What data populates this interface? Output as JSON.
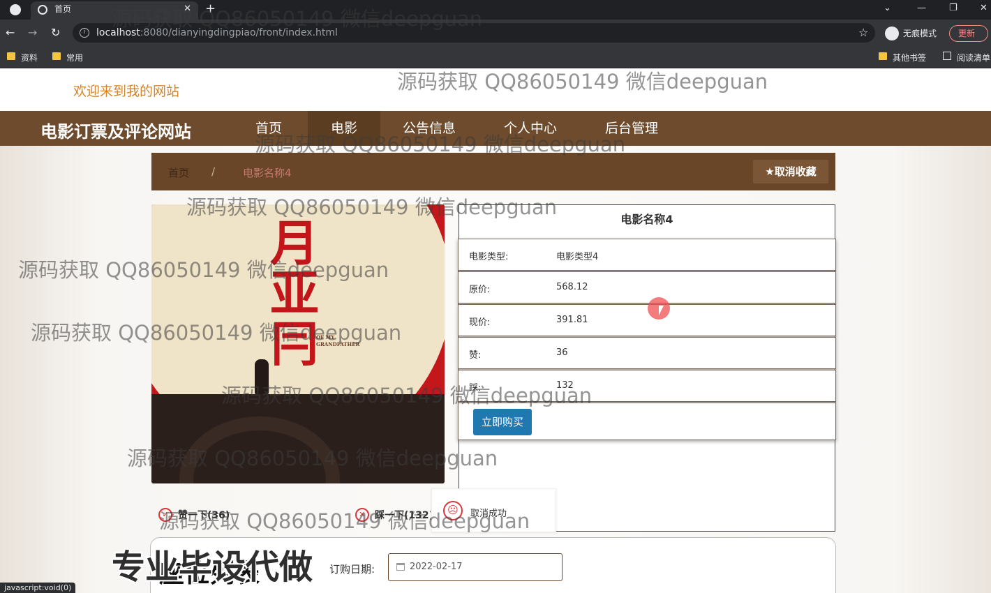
{
  "browser": {
    "tab_title": "首页",
    "url_host": "localhost",
    "url_rest": ":8080/dianyingdingpiao/front/index.html",
    "incognito_label": "无痕模式",
    "update_label": "更新",
    "bookmarks": [
      "资料",
      "常用"
    ],
    "bookmarks_right": [
      "其他书签",
      "阅读清单"
    ],
    "status_text": "javascript:void(0)"
  },
  "site": {
    "welcome": "欢迎来到我的网站",
    "title": "电影订票及评论网站",
    "nav": [
      "首页",
      "电影",
      "公告信息",
      "个人中心",
      "后台管理"
    ],
    "active_nav": "电影"
  },
  "breadcrumb": {
    "home": "首页",
    "separator": "/",
    "current": "电影名称4"
  },
  "favorite_button": "★取消收藏",
  "poster": {
    "subtitle_en": "OF MY GRANDFATHER"
  },
  "movie": {
    "name": "电影名称4",
    "fields": [
      {
        "label": "电影类型:",
        "value": "电影类型4"
      },
      {
        "label": "原价:",
        "value": "568.12"
      },
      {
        "label": "现价:",
        "value": "391.81"
      },
      {
        "label": "赞:",
        "value": "36"
      },
      {
        "label": "踩:",
        "value": "132"
      }
    ],
    "buy_button": "立即购买"
  },
  "votes": {
    "like": "赞一下(36)",
    "dislike": "踩一下(132)"
  },
  "toast": {
    "message": "取消成功"
  },
  "seat_section": {
    "title": "座位列表",
    "date_label": "订购日期:",
    "date_value": "2022-02-17"
  },
  "overlay_banner": "专业毕设代做",
  "watermark": "源码获取 QQ86050149 微信deepguan",
  "colors": {
    "nav_bg": "#6d4b2c",
    "accent_orange": "#d2852a",
    "buy_blue": "#2078b0",
    "vote_red": "#d9363e"
  }
}
